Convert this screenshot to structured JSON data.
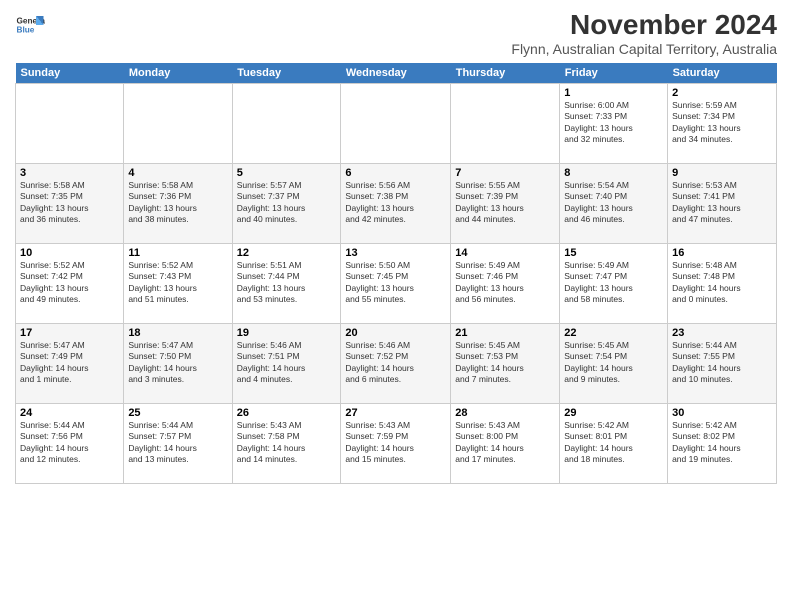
{
  "header": {
    "logo_line1": "General",
    "logo_line2": "Blue",
    "month_title": "November 2024",
    "subtitle": "Flynn, Australian Capital Territory, Australia"
  },
  "days_of_week": [
    "Sunday",
    "Monday",
    "Tuesday",
    "Wednesday",
    "Thursday",
    "Friday",
    "Saturday"
  ],
  "weeks": [
    [
      {
        "day": "",
        "info": ""
      },
      {
        "day": "",
        "info": ""
      },
      {
        "day": "",
        "info": ""
      },
      {
        "day": "",
        "info": ""
      },
      {
        "day": "",
        "info": ""
      },
      {
        "day": "1",
        "info": "Sunrise: 6:00 AM\nSunset: 7:33 PM\nDaylight: 13 hours\nand 32 minutes."
      },
      {
        "day": "2",
        "info": "Sunrise: 5:59 AM\nSunset: 7:34 PM\nDaylight: 13 hours\nand 34 minutes."
      }
    ],
    [
      {
        "day": "3",
        "info": "Sunrise: 5:58 AM\nSunset: 7:35 PM\nDaylight: 13 hours\nand 36 minutes."
      },
      {
        "day": "4",
        "info": "Sunrise: 5:58 AM\nSunset: 7:36 PM\nDaylight: 13 hours\nand 38 minutes."
      },
      {
        "day": "5",
        "info": "Sunrise: 5:57 AM\nSunset: 7:37 PM\nDaylight: 13 hours\nand 40 minutes."
      },
      {
        "day": "6",
        "info": "Sunrise: 5:56 AM\nSunset: 7:38 PM\nDaylight: 13 hours\nand 42 minutes."
      },
      {
        "day": "7",
        "info": "Sunrise: 5:55 AM\nSunset: 7:39 PM\nDaylight: 13 hours\nand 44 minutes."
      },
      {
        "day": "8",
        "info": "Sunrise: 5:54 AM\nSunset: 7:40 PM\nDaylight: 13 hours\nand 46 minutes."
      },
      {
        "day": "9",
        "info": "Sunrise: 5:53 AM\nSunset: 7:41 PM\nDaylight: 13 hours\nand 47 minutes."
      }
    ],
    [
      {
        "day": "10",
        "info": "Sunrise: 5:52 AM\nSunset: 7:42 PM\nDaylight: 13 hours\nand 49 minutes."
      },
      {
        "day": "11",
        "info": "Sunrise: 5:52 AM\nSunset: 7:43 PM\nDaylight: 13 hours\nand 51 minutes."
      },
      {
        "day": "12",
        "info": "Sunrise: 5:51 AM\nSunset: 7:44 PM\nDaylight: 13 hours\nand 53 minutes."
      },
      {
        "day": "13",
        "info": "Sunrise: 5:50 AM\nSunset: 7:45 PM\nDaylight: 13 hours\nand 55 minutes."
      },
      {
        "day": "14",
        "info": "Sunrise: 5:49 AM\nSunset: 7:46 PM\nDaylight: 13 hours\nand 56 minutes."
      },
      {
        "day": "15",
        "info": "Sunrise: 5:49 AM\nSunset: 7:47 PM\nDaylight: 13 hours\nand 58 minutes."
      },
      {
        "day": "16",
        "info": "Sunrise: 5:48 AM\nSunset: 7:48 PM\nDaylight: 14 hours\nand 0 minutes."
      }
    ],
    [
      {
        "day": "17",
        "info": "Sunrise: 5:47 AM\nSunset: 7:49 PM\nDaylight: 14 hours\nand 1 minute."
      },
      {
        "day": "18",
        "info": "Sunrise: 5:47 AM\nSunset: 7:50 PM\nDaylight: 14 hours\nand 3 minutes."
      },
      {
        "day": "19",
        "info": "Sunrise: 5:46 AM\nSunset: 7:51 PM\nDaylight: 14 hours\nand 4 minutes."
      },
      {
        "day": "20",
        "info": "Sunrise: 5:46 AM\nSunset: 7:52 PM\nDaylight: 14 hours\nand 6 minutes."
      },
      {
        "day": "21",
        "info": "Sunrise: 5:45 AM\nSunset: 7:53 PM\nDaylight: 14 hours\nand 7 minutes."
      },
      {
        "day": "22",
        "info": "Sunrise: 5:45 AM\nSunset: 7:54 PM\nDaylight: 14 hours\nand 9 minutes."
      },
      {
        "day": "23",
        "info": "Sunrise: 5:44 AM\nSunset: 7:55 PM\nDaylight: 14 hours\nand 10 minutes."
      }
    ],
    [
      {
        "day": "24",
        "info": "Sunrise: 5:44 AM\nSunset: 7:56 PM\nDaylight: 14 hours\nand 12 minutes."
      },
      {
        "day": "25",
        "info": "Sunrise: 5:44 AM\nSunset: 7:57 PM\nDaylight: 14 hours\nand 13 minutes."
      },
      {
        "day": "26",
        "info": "Sunrise: 5:43 AM\nSunset: 7:58 PM\nDaylight: 14 hours\nand 14 minutes."
      },
      {
        "day": "27",
        "info": "Sunrise: 5:43 AM\nSunset: 7:59 PM\nDaylight: 14 hours\nand 15 minutes."
      },
      {
        "day": "28",
        "info": "Sunrise: 5:43 AM\nSunset: 8:00 PM\nDaylight: 14 hours\nand 17 minutes."
      },
      {
        "day": "29",
        "info": "Sunrise: 5:42 AM\nSunset: 8:01 PM\nDaylight: 14 hours\nand 18 minutes."
      },
      {
        "day": "30",
        "info": "Sunrise: 5:42 AM\nSunset: 8:02 PM\nDaylight: 14 hours\nand 19 minutes."
      }
    ]
  ]
}
